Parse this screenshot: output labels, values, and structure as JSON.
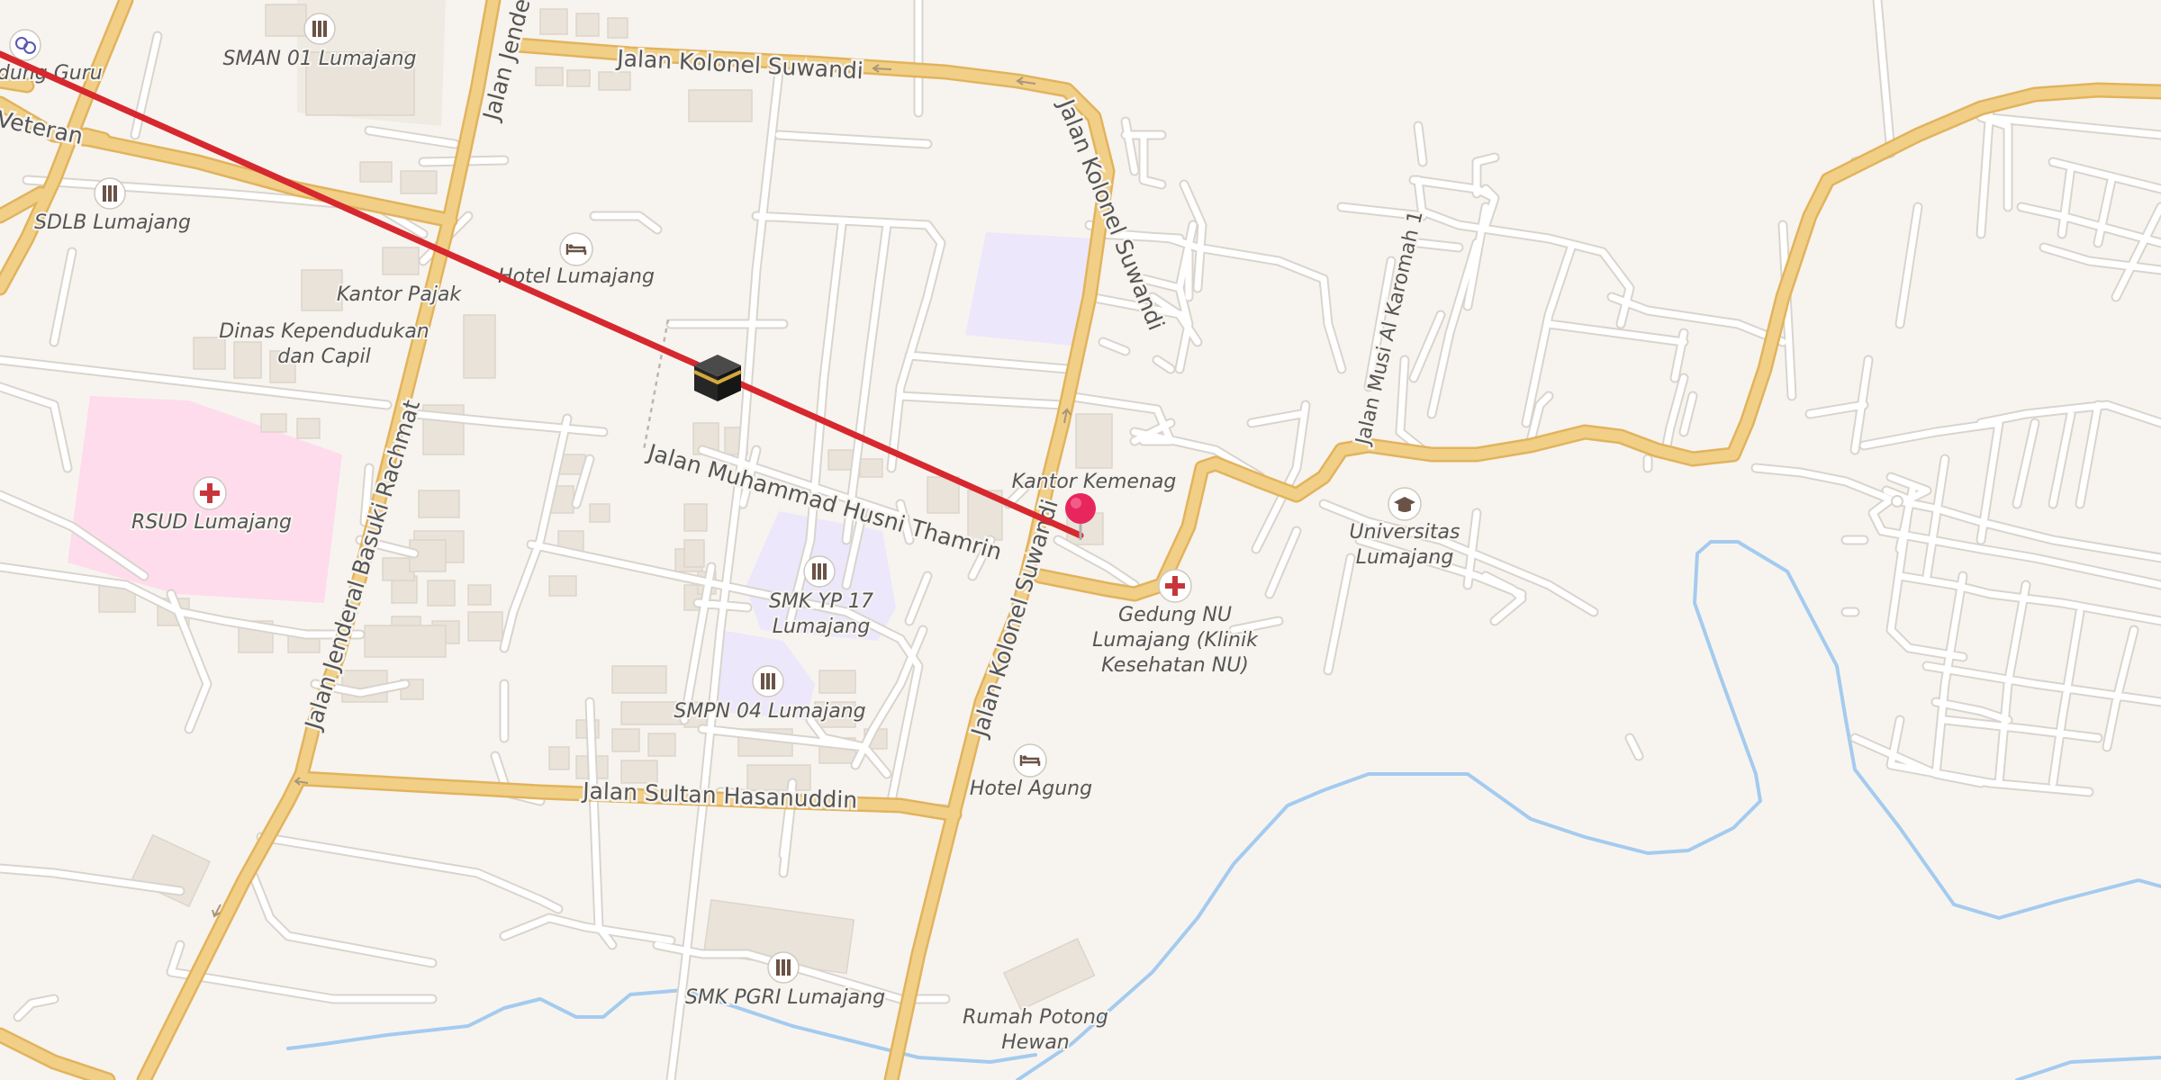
{
  "map": {
    "colors": {
      "background": "#f7f4ef",
      "major_road": "#f1cf86",
      "major_road_casing": "#e2b35d",
      "minor_road": "#ffffff",
      "minor_road_casing": "#d9d4cc",
      "building": "#e9e3da",
      "hospital_area": "#fedcec",
      "school_area": "#ece7fa",
      "water": "#a4cbef",
      "qibla_line": "#d6282e",
      "pin": "#e8265e"
    },
    "roads": {
      "kolonel_suwandi_north": "Jalan Kolonel Suwandi",
      "kolonel_suwandi_ne": "Jalan Kolonel Suwandi",
      "kolonel_suwandi_east": "Jalan Kolonel Suwandi",
      "kolonel_suwandi_south": "Jalan Kolonel Suwandi",
      "husni_thamrin": "Jalan Muhammad Husni Thamrin",
      "sultan_hasanuddin": "Jalan Sultan Hasanuddin",
      "basuki_rachmat": "Jalan Jenderal Basuki Rachmat",
      "jenderal_top": "Jalan Jenderal",
      "veteran": "Veteran",
      "musi_al_karomah": "Jalan Musi Al Karomah 1"
    },
    "pois": {
      "gedung_guru": "Gedung Guru",
      "sman01": "SMAN 01 Lumajang",
      "sdlb": "SDLB Lumajang",
      "hotel_lumajang": "Hotel Lumajang",
      "kantor_pajak": "Kantor Pajak",
      "dinas_line1": "Dinas Kependudukan",
      "dinas_line2": "dan Capil",
      "rsud": "RSUD Lumajang",
      "kantor_kemenag": "Kantor Kemenag",
      "smk_yp17_line1": "SMK YP 17",
      "smk_yp17_line2": "Lumajang",
      "smpn04": "SMPN 04 Lumajang",
      "gedung_nu_line1": "Gedung NU",
      "gedung_nu_line2": "Lumajang (Klinik",
      "gedung_nu_line3": "Kesehatan NU)",
      "universitas_line1": "Universitas",
      "universitas_line2": "Lumajang",
      "hotel_agung": "Hotel Agung",
      "smk_pgri": "SMK PGRI Lumajang",
      "rumah_potong_line1": "Rumah Potong",
      "rumah_potong_line2": "Hewan"
    },
    "icons": {
      "school": "school-icon",
      "hotel": "hotel-icon",
      "hospital": "hospital-cross-icon",
      "university": "graduation-cap-icon",
      "theatre": "theatre-masks-icon",
      "kaaba": "kaaba-icon",
      "pin": "location-pin-icon"
    }
  }
}
